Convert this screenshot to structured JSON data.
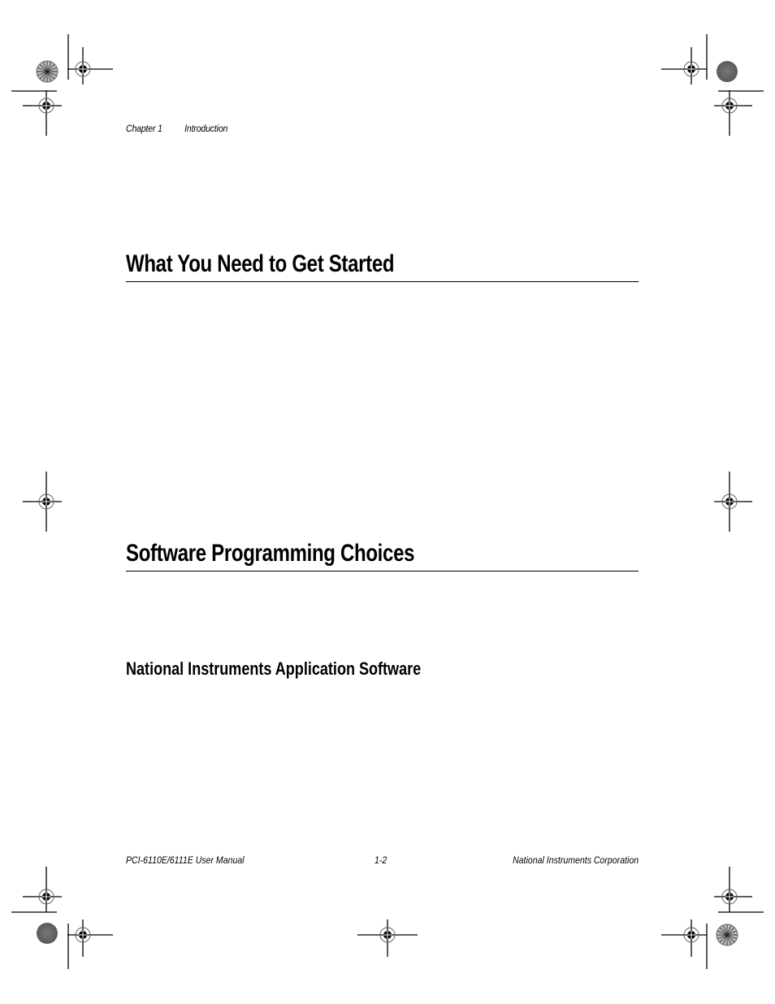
{
  "running_head": {
    "chapter": "Chapter 1",
    "title": "Introduction"
  },
  "sections": [
    {
      "heading": "What You Need to Get Started",
      "level": 1
    },
    {
      "heading": "Software Programming Choices",
      "level": 1
    },
    {
      "heading": "National Instruments Application Software",
      "level": 2
    }
  ],
  "footer": {
    "manual_title": "PCI-6110E/6111E User Manual",
    "page_number": "1-2",
    "company": "National Instruments Corporation"
  },
  "print_marks": {
    "icons": [
      "registration-crosshair-icon",
      "starburst-target-icon",
      "gray-density-circle-icon",
      "crop-line"
    ]
  }
}
